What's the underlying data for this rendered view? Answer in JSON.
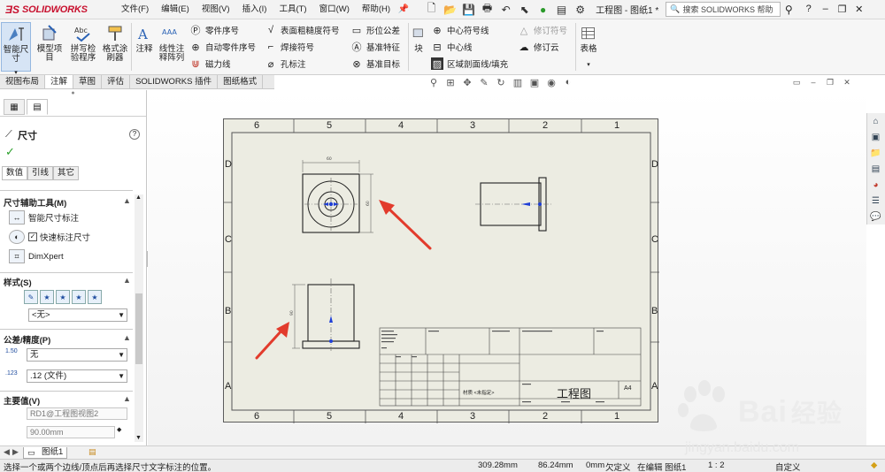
{
  "app": {
    "logo_text": "SOLIDWORKS",
    "menu": [
      "文件(F)",
      "编辑(E)",
      "视图(V)",
      "插入(I)",
      "工具(T)",
      "窗口(W)",
      "帮助(H)"
    ],
    "doc_title": "工程图 - 图纸1 *",
    "search_placeholder": "搜索 SOLIDWORKS 帮助",
    "help_glyph": "?",
    "min_glyph": "–",
    "restore_glyph": "❐",
    "close_glyph": "✕"
  },
  "ribbon": {
    "smart_dim": "智能尺寸",
    "model_items": "模型项目",
    "spell": "拼写检验程序",
    "format_painter": "格式涂刷器",
    "note": "注释",
    "linear_note": "线性注释阵列",
    "balloon": "零件序号",
    "auto_balloon": "自动零件序号",
    "magnetic_line": "磁力线",
    "surface_finish": "表面粗糙度符号",
    "weld": "焊接符号",
    "hole_callout": "孔标注",
    "gtol": "形位公差",
    "datum_feature": "基准特征",
    "datum_target": "基准目标",
    "block": "块",
    "center_mark": "中心符号线",
    "centerline": "中心线",
    "area_hatch": "区域剖面线/填充",
    "revision_symbol": "修订符号",
    "revision_cloud": "修订云",
    "table": "表格"
  },
  "tabs": [
    "视图布局",
    "注解",
    "草图",
    "评估",
    "SOLIDWORKS 插件",
    "图纸格式"
  ],
  "pm": {
    "title": "尺寸",
    "subtabs": [
      "数值",
      "引线",
      "其它"
    ],
    "grp_tools": "尺寸辅助工具(M)",
    "smart_dim_label": "智能尺寸标注",
    "quick_dim_label": "快速标注尺寸",
    "dimxpert_label": "DimXpert",
    "grp_style": "样式(S)",
    "style_value": "<无>",
    "grp_tol": "公差/精度(P)",
    "tol_value": "无",
    "prec_value": ".12 (文件)",
    "grp_primary": "主要值(V)",
    "primary_name": "RD1@工程图视图2",
    "primary_value": "90.00mm"
  },
  "sheet": {
    "cols": [
      "6",
      "5",
      "4",
      "3",
      "2",
      "1"
    ],
    "rows": [
      "D",
      "C",
      "B",
      "A"
    ],
    "title_block_title": "工程图",
    "size_code": "A4",
    "material_field": "材质 <未指定>"
  },
  "bottom": {
    "sheet_tab": "图纸1",
    "status_text": "选择一个或两个边线/顶点后再选择尺寸文字标注的位置。",
    "x_coord": "309.28mm",
    "y_coord": "86.24mm",
    "z_coord": "0mm",
    "define_state": "欠定义",
    "edit_state": "在编辑 图纸1",
    "scale": "1 : 2",
    "units": "自定义"
  },
  "watermark": {
    "brand": "Bai",
    "brand_cn": "经验",
    "url": "jingyan.baidu.com"
  },
  "colors": {
    "accent": "#1f6fc5",
    "sheet": "#ecece2",
    "arrow": "#e23b2c",
    "logo": "#c8102e"
  }
}
